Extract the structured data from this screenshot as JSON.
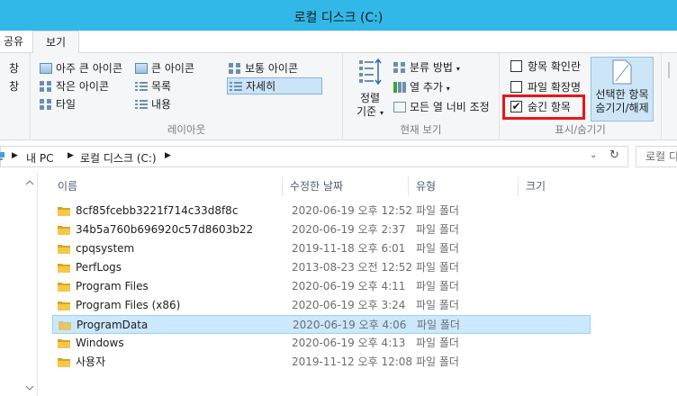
{
  "window": {
    "title": "로컬 디스크 (C:)"
  },
  "tabs": {
    "share": "공유",
    "view": "보기"
  },
  "nav_pane": {
    "row1": "창",
    "row2": "창"
  },
  "layout": {
    "items": [
      {
        "label": "아주 큰 아이콘",
        "icon": "large-icon"
      },
      {
        "label": "작은 아이콘",
        "icon": "grid-icon"
      },
      {
        "label": "타일",
        "icon": "grid-icon"
      },
      {
        "label": "큰 아이콘",
        "icon": "large-icon"
      },
      {
        "label": "목록",
        "icon": "list-icon"
      },
      {
        "label": "내용",
        "icon": "list-icon"
      },
      {
        "label": "보통 아이콘",
        "icon": "grid-icon"
      },
      {
        "label": "자세히",
        "icon": "list-icon",
        "selected": true
      }
    ],
    "group_label": "레이아웃"
  },
  "current_view": {
    "sort_line1": "정렬",
    "sort_line2": "기준",
    "group_by": "분류 방법",
    "add_column": "열 추가",
    "fit_columns": "모든 열 너비 조정",
    "group_label": "현재 보기"
  },
  "show_hide": {
    "item_checkboxes": {
      "label": "항목 확인란",
      "checked": false
    },
    "file_extensions": {
      "label": "파일 확장명",
      "checked": false
    },
    "hidden_items": {
      "label": "숨긴 항목",
      "checked": true
    },
    "hide_selected_line1": "선택한 항목",
    "hide_selected_line2": "숨기기/해제",
    "group_label": "표시/숨기기"
  },
  "address": {
    "crumbs": [
      "내 PC",
      "로컬 디스크 (C:)"
    ],
    "search_placeholder": "로컬 디"
  },
  "columns": {
    "name": "이름",
    "modified": "수정한 날짜",
    "type": "유형",
    "size": "크기"
  },
  "files": [
    {
      "name": "8cf85fcebb3221f714c33d8f8c",
      "modified": "2020-06-19 오후 12:52",
      "type": "파일 폴더"
    },
    {
      "name": "34b5a760b696920c57d8603b22",
      "modified": "2020-06-19 오후 2:37",
      "type": "파일 폴더"
    },
    {
      "name": "cpqsystem",
      "modified": "2019-11-18 오후 6:01",
      "type": "파일 폴더"
    },
    {
      "name": "PerfLogs",
      "modified": "2013-08-23 오전 12:52",
      "type": "파일 폴더"
    },
    {
      "name": "Program Files",
      "modified": "2020-06-19 오후 4:11",
      "type": "파일 폴더"
    },
    {
      "name": "Program Files (x86)",
      "modified": "2020-06-19 오후 3:24",
      "type": "파일 폴더"
    },
    {
      "name": "ProgramData",
      "modified": "2020-06-19 오후 4:06",
      "type": "파일 폴더",
      "selected": true,
      "faded": true
    },
    {
      "name": "Windows",
      "modified": "2020-06-19 오후 4:13",
      "type": "파일 폴더"
    },
    {
      "name": "사용자",
      "modified": "2019-11-12 오후 12:08",
      "type": "파일 폴더"
    }
  ],
  "colors": {
    "titlebar": "#31b8e8",
    "highlight": "#e8151b",
    "selection": "#cce8ff",
    "folder": "#e8b93a"
  }
}
